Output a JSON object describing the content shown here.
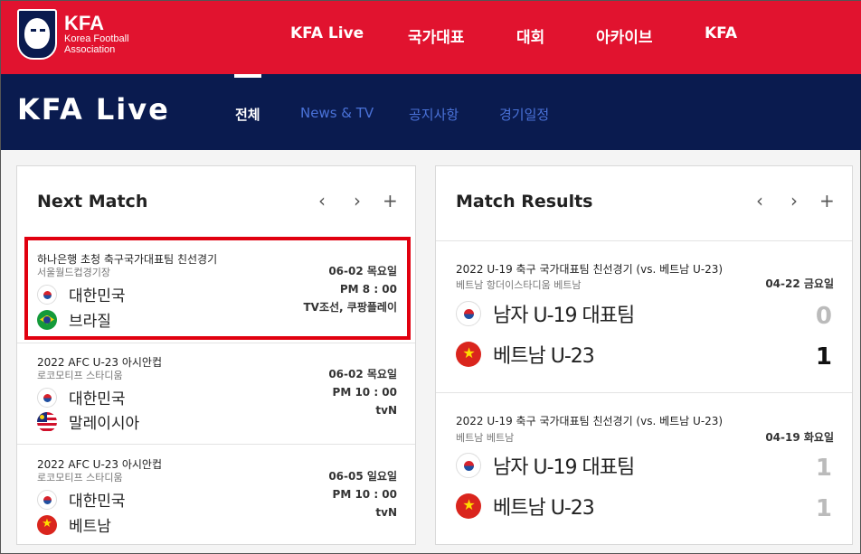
{
  "header": {
    "logo_title": "KFA",
    "logo_sub_1": "Korea Football",
    "logo_sub_2": "Association",
    "nav": [
      "KFA Live",
      "국가대표",
      "대회",
      "아카이브",
      "KFA"
    ]
  },
  "hero": {
    "title": "KFA Live",
    "tabs": [
      "전체",
      "News & TV",
      "공지사항",
      "경기일정"
    ],
    "active_tab": "전체"
  },
  "next_match": {
    "title": "Next Match",
    "controls": {
      "prev": "‹",
      "next": "›",
      "more": "+"
    },
    "matches": [
      {
        "title": "하나은행 초청 축구국가대표팀 친선경기",
        "venue": "서울월드컵경기장",
        "home": {
          "name": "대한민국",
          "flag": "korea-flag-icon"
        },
        "away": {
          "name": "브라질",
          "flag": "brazil-flag-icon"
        },
        "date": "06-02 목요일",
        "time": "PM 8 : 00",
        "broadcast": "TV조선, 쿠팡플레이"
      },
      {
        "title": "2022 AFC U-23 아시안컵",
        "venue": "로코모티프 스타디움",
        "home": {
          "name": "대한민국",
          "flag": "korea-flag-icon"
        },
        "away": {
          "name": "말레이시아",
          "flag": "malaysia-flag-icon"
        },
        "date": "06-02 목요일",
        "time": "PM 10 : 00",
        "broadcast": "tvN"
      },
      {
        "title": "2022 AFC U-23 아시안컵",
        "venue": "로코모티프 스타디움",
        "home": {
          "name": "대한민국",
          "flag": "korea-flag-icon"
        },
        "away": {
          "name": "베트남",
          "flag": "vietnam-flag-icon"
        },
        "date": "06-05 일요일",
        "time": "PM 10 : 00",
        "broadcast": "tvN"
      }
    ]
  },
  "match_results": {
    "title": "Match Results",
    "controls": {
      "prev": "‹",
      "next": "›",
      "more": "+"
    },
    "results": [
      {
        "title": "2022 U-19 축구 국가대표팀 친선경기 (vs. 베트남 U-23)",
        "venue": "베트남  항더이스타디움 베트남",
        "date": "04-22 금요일",
        "home": {
          "name": "남자 U-19 대표팀",
          "score": "0",
          "flag": "korea-flag-icon"
        },
        "away": {
          "name": "베트남 U-23",
          "score": "1",
          "flag": "vietnam-flag-icon"
        }
      },
      {
        "title": "2022 U-19 축구 국가대표팀 친선경기 (vs. 베트남 U-23)",
        "venue": "베트남  베트남",
        "date": "04-19 화요일",
        "home": {
          "name": "남자 U-19 대표팀",
          "score": "1",
          "flag": "korea-flag-icon"
        },
        "away": {
          "name": "베트남 U-23",
          "score": "1",
          "flag": "vietnam-flag-icon"
        }
      }
    ]
  },
  "colors": {
    "brand_red": "#e1132f",
    "brand_navy": "#0a1b4f",
    "tab_blue": "#4a72d8",
    "highlight": "#e1000f"
  }
}
